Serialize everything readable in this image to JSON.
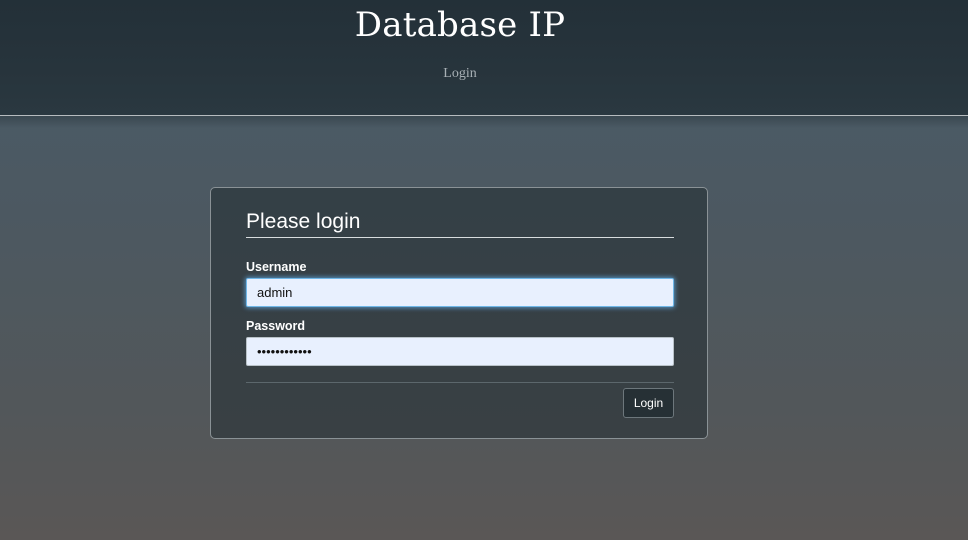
{
  "header": {
    "title": "Database IP",
    "subtitle": "Login"
  },
  "login_form": {
    "heading": "Please login",
    "username_label": "Username",
    "username_value": "admin",
    "password_label": "Password",
    "password_value": "••••••••••••",
    "submit_label": "Login"
  },
  "colors": {
    "header_bg": "#27343c",
    "input_bg": "#e8f0fe",
    "focus_glow": "#6fb7e8",
    "button_bg": "#263035"
  }
}
